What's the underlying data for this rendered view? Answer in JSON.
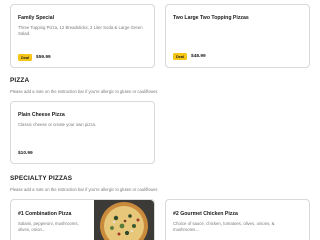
{
  "deals": [
    {
      "title": "Family Special",
      "description": "Three Topping Pizza, 12 Breadsticks, 2 Liter Soda & Large Green Salad.",
      "badge": "Deal",
      "price": "$59.99"
    },
    {
      "title": "Two Large Two Topping Pizzas",
      "badge": "Deal",
      "price": "$48.99"
    }
  ],
  "pizza_section": {
    "title": "PIZZA",
    "note": "Please add a note on the instruction bar if you're allergic to gluten or cauliflower.",
    "items": [
      {
        "title": "Plain Cheese Pizza",
        "description": "Classic cheese or create your own pizza.",
        "price": "$10.99"
      }
    ]
  },
  "specialty_section": {
    "title": "SPECIALTY PIZZAS",
    "note": "Please add a note on the instruction bar if you're allergic to gluten or cauliflower.",
    "items": [
      {
        "title": "#1 Combination Pizza",
        "description": "Salami, pepperoni, mushrooms, olives, onion...",
        "image": "pizza-photo"
      },
      {
        "title": "#2 Gourmet Chicken Pizza",
        "description": "Choice of sauce, chicken, tomatoes, olives, onions, & mushrooms..."
      }
    ]
  },
  "colors": {
    "deal_badge": "#f5c518",
    "card_border": "#d9d9d9",
    "muted_text": "#7a7a7a"
  }
}
